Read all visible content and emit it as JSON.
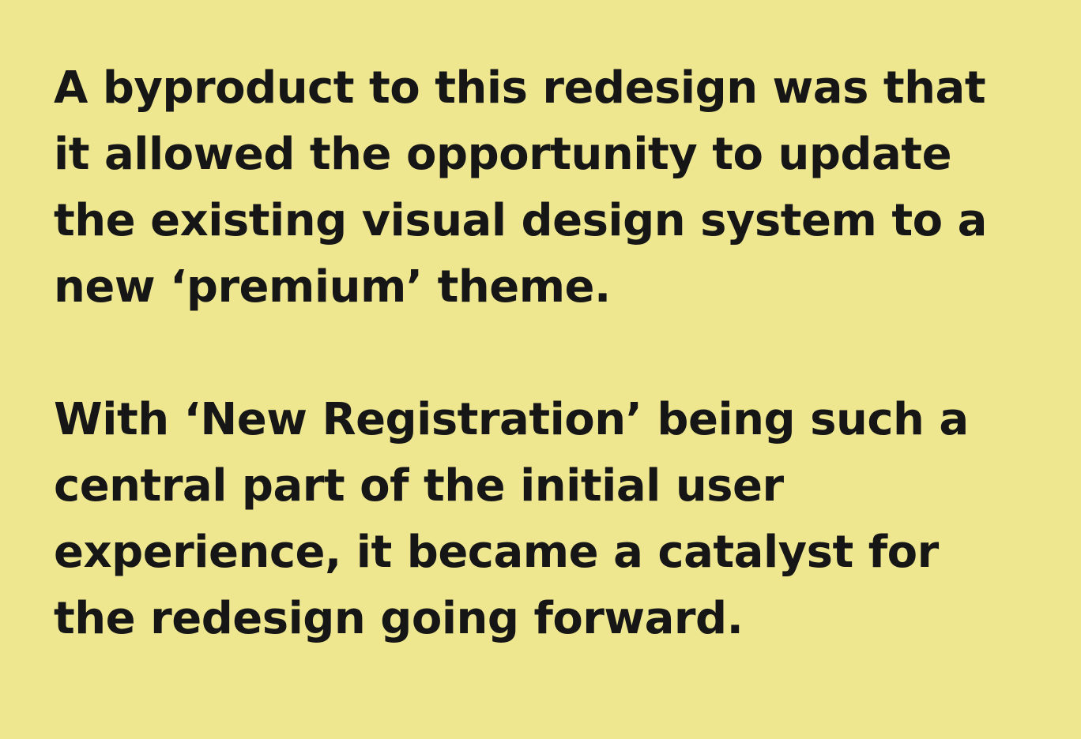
{
  "paragraphs": [
    {
      "lines": [
        "A byproduct to this redesign was that",
        "it allowed the opportunity to update",
        "the existing visual design system to a",
        "new ‘premium’ theme."
      ]
    },
    {
      "lines": [
        "With ‘New Registration’ being such a",
        "central part of the initial user",
        "experience, it became a catalyst for",
        "the redesign going forward."
      ]
    }
  ],
  "colors": {
    "background": "#EEE790",
    "text": "#161616"
  }
}
